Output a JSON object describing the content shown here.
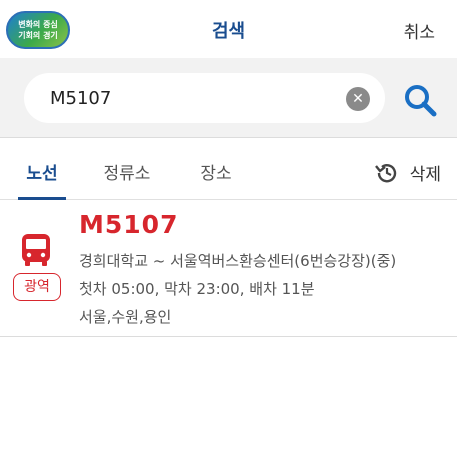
{
  "header": {
    "logo_line1": "변화의 중심",
    "logo_line2": "기회의 경기",
    "title": "검색",
    "cancel_label": "취소"
  },
  "search": {
    "value": "M5107",
    "clear_icon": "clear-icon",
    "search_icon": "search-icon"
  },
  "tabs": {
    "items": [
      {
        "label": "노선",
        "active": true
      },
      {
        "label": "정류소",
        "active": false
      },
      {
        "label": "장소",
        "active": false
      }
    ],
    "delete_label": "삭제",
    "delete_icon": "history-icon"
  },
  "results": [
    {
      "type_badge": "광역",
      "route_name": "M5107",
      "description": "경희대학교 ~ 서울역버스환승센터(6번승강장)(중)",
      "schedule": "첫차 05:00, 막차 23:00, 배차 11분",
      "area": "서울,수원,용인",
      "icon": "bus-icon"
    }
  ],
  "colors": {
    "accent_blue": "#1a4d8f",
    "route_red": "#d7262d",
    "search_bg": "#f2f2f2"
  }
}
